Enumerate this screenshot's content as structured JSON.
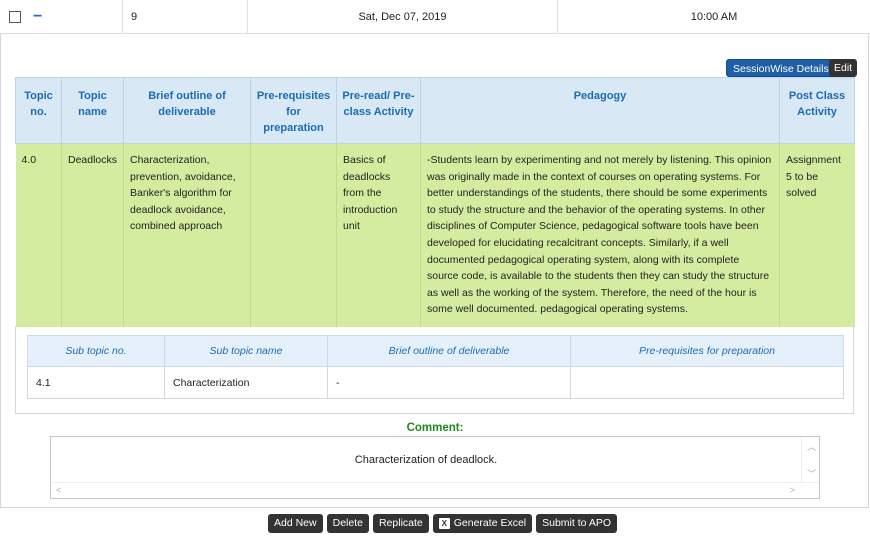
{
  "session": {
    "number": "9",
    "date": "Sat, Dec 07, 2019",
    "time": "10:00 AM"
  },
  "actions": {
    "sessionwise_label": "SessionWise Details",
    "edit_label": "Edit"
  },
  "main_table": {
    "headers": [
      "Topic no.",
      "Topic name",
      "Brief outline of deliverable",
      "Pre-requisites for preparation",
      "Pre-read/ Pre-class Activity",
      "Pedagogy",
      "Post Class Activity"
    ],
    "row": {
      "topic_no": "4.0",
      "topic_name": "Deadlocks",
      "outline": "Characterization, prevention, avoidance, Banker's algorithm for deadlock avoidance, combined approach",
      "prerequisites": "",
      "preread": "Basics of deadlocks from the introduction unit",
      "pedagogy": "-Students learn by experimenting and not merely by listening. This opinion was originally made in the context of courses on operating systems. For better understandings of the students, there should be some experiments to study the structure and the behavior of the operating systems. In other disciplines of Computer Science, pedagogical software tools have been developed for elucidating recalcitrant concepts. Similarly, if a well documented pedagogical operating system, along with its complete source code, is available to the students then they can study the structure as well as the working of the system. Therefore, the need of the hour is some well documented. pedagogical operating systems.",
      "post_class": "Assignment 5 to be solved"
    }
  },
  "sub_table": {
    "headers": [
      "Sub topic no.",
      "Sub topic name",
      "Brief outline of deliverable",
      "Pre-requisites for preparation"
    ],
    "row": {
      "no": "4.1",
      "name": "Characterization",
      "outline": "-",
      "prereq": ""
    }
  },
  "comment": {
    "label": "Comment:",
    "text": "Characterization of deadlock."
  },
  "toolbar": {
    "add_new": "Add New",
    "delete": "Delete",
    "replicate": "Replicate",
    "generate_excel": "Generate Excel",
    "submit": "Submit to APO"
  },
  "colors": {
    "header_bg": "#d9e8f5",
    "header_text": "#1b6bb5",
    "row_bg": "#d4ec9f",
    "primary_button": "#1f5fa8",
    "dark_button": "#333333",
    "comment_label": "#1c8a1c"
  }
}
